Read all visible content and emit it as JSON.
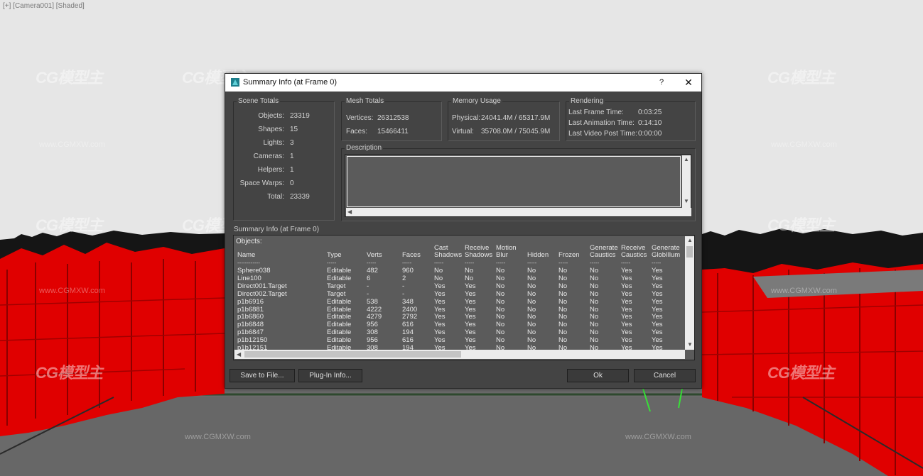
{
  "viewport": {
    "label": "[+] [Camera001] [Shaded]",
    "watermark_logo": "CG模型主",
    "watermark_url": "www.CGMXW.com",
    "colors": {
      "sky": "#e6e6e6",
      "buildings": "#e00000",
      "ground": "#6a6a6a",
      "skyline": "#151515"
    }
  },
  "dialog": {
    "title": "Summary Info (at Frame 0)",
    "help": "?",
    "close": "✕",
    "scene_totals": {
      "title": "Scene Totals",
      "rows": [
        {
          "label": "Objects:",
          "value": "23319"
        },
        {
          "label": "Shapes:",
          "value": "15"
        },
        {
          "label": "Lights:",
          "value": "3"
        },
        {
          "label": "Cameras:",
          "value": "1"
        },
        {
          "label": "Helpers:",
          "value": "1"
        },
        {
          "label": "Space Warps:",
          "value": "0"
        },
        {
          "label": "Total:",
          "value": "23339"
        }
      ]
    },
    "mesh_totals": {
      "title": "Mesh Totals",
      "vertices_label": "Vertices:",
      "vertices": "26312538",
      "faces_label": "Faces:",
      "faces": "15466411"
    },
    "memory_usage": {
      "title": "Memory Usage",
      "physical_label": "Physical:",
      "physical": "24041.4M / 65317.9M",
      "virtual_label": "Virtual:",
      "virtual": "35708.0M / 75045.9M"
    },
    "rendering": {
      "title": "Rendering",
      "last_frame_label": "Last Frame Time:",
      "last_frame": "0:03:25",
      "last_anim_label": "Last Animation Time:",
      "last_anim": "0:14:10",
      "last_post_label": "Last Video Post Time:",
      "last_post": "0:00:00"
    },
    "description": {
      "title": "Description",
      "text": ""
    },
    "summary": {
      "label": "Summary Info (at Frame 0)",
      "objects_label": "Objects:",
      "headers": [
        [
          "",
          "Name"
        ],
        [
          "",
          "Type"
        ],
        [
          "",
          "Verts"
        ],
        [
          "",
          "Faces"
        ],
        [
          "Cast",
          "Shadows"
        ],
        [
          "Receive",
          "Shadows"
        ],
        [
          "Motion",
          "Blur"
        ],
        [
          "",
          "Hidden"
        ],
        [
          "",
          "Frozen"
        ],
        [
          "Generate",
          "Caustics"
        ],
        [
          "Receive",
          "Caustics"
        ],
        [
          "Generate",
          "GlobIllum"
        ]
      ],
      "rows": [
        [
          "Sphere038",
          "Editable",
          "482",
          "960",
          "No",
          "No",
          "No",
          "No",
          "No",
          "No",
          "Yes",
          "Yes"
        ],
        [
          "Line100",
          "Editable",
          "6",
          "2",
          "No",
          "No",
          "No",
          "No",
          "No",
          "No",
          "Yes",
          "Yes"
        ],
        [
          "Direct001.Target",
          "Target",
          "-",
          "-",
          "Yes",
          "Yes",
          "No",
          "No",
          "No",
          "No",
          "Yes",
          "Yes"
        ],
        [
          "Direct002.Target",
          "Target",
          "-",
          "-",
          "Yes",
          "Yes",
          "No",
          "No",
          "No",
          "No",
          "Yes",
          "Yes"
        ],
        [
          "p1b6916",
          "Editable",
          "538",
          "348",
          "Yes",
          "Yes",
          "No",
          "No",
          "No",
          "No",
          "Yes",
          "Yes"
        ],
        [
          "p1b6881",
          "Editable",
          "4222",
          "2400",
          "Yes",
          "Yes",
          "No",
          "No",
          "No",
          "No",
          "Yes",
          "Yes"
        ],
        [
          "p1b6860",
          "Editable",
          "4279",
          "2792",
          "Yes",
          "Yes",
          "No",
          "No",
          "No",
          "No",
          "Yes",
          "Yes"
        ],
        [
          "p1b6848",
          "Editable",
          "956",
          "616",
          "Yes",
          "Yes",
          "No",
          "No",
          "No",
          "No",
          "Yes",
          "Yes"
        ],
        [
          "p1b6847",
          "Editable",
          "308",
          "194",
          "Yes",
          "Yes",
          "No",
          "No",
          "No",
          "No",
          "Yes",
          "Yes"
        ],
        [
          "p1b12150",
          "Editable",
          "956",
          "616",
          "Yes",
          "Yes",
          "No",
          "No",
          "No",
          "No",
          "Yes",
          "Yes"
        ],
        [
          "p1b12151",
          "Editable",
          "308",
          "194",
          "Yes",
          "Yes",
          "No",
          "No",
          "No",
          "No",
          "Yes",
          "Yes"
        ]
      ]
    },
    "buttons": {
      "save": "Save to File...",
      "plugin": "Plug-In Info...",
      "ok": "Ok",
      "cancel": "Cancel"
    }
  }
}
